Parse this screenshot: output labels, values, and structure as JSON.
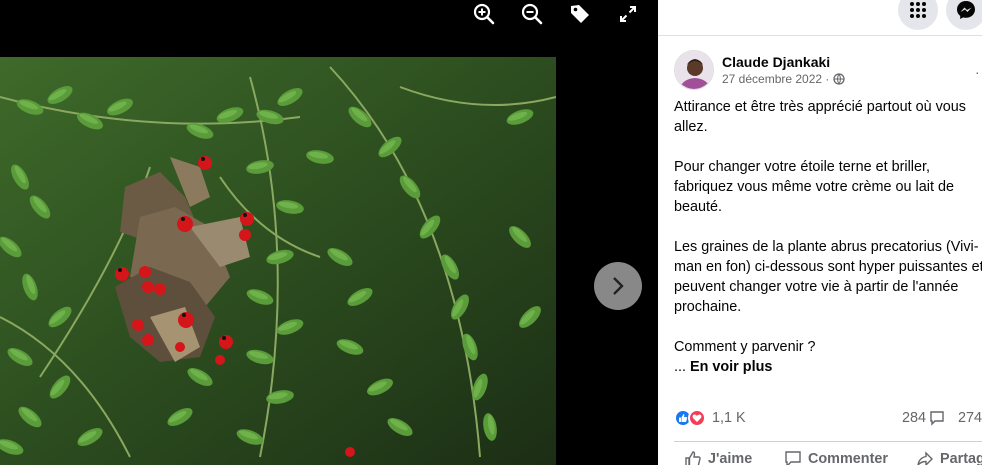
{
  "viewer": {
    "toolbar": {
      "zoom_in_icon": "zoom-in-icon",
      "zoom_out_icon": "zoom-out-icon",
      "tag_icon": "tag-icon",
      "fullscreen_icon": "fullscreen-icon"
    },
    "photo": {
      "subject": "abrus precatorius seed pods with red seeds among green leaves"
    },
    "next_icon": "chevron-right-icon"
  },
  "panel": {
    "top_buttons": {
      "menu_icon": "grid-menu-icon",
      "messenger_icon": "messenger-icon"
    },
    "author": {
      "name": "Claude Djankaki",
      "date": "27 décembre 2022 ·",
      "privacy_icon": "globe-icon"
    },
    "post": {
      "paragraphs": [
        "Attirance et être très apprécié partout où vous",
        "allez.",
        "Pour changer votre étoile terne et briller,",
        "fabriquez vous même votre crème ou lait de",
        "beauté.",
        "Les graines de la plante abrus precatorius (Vivi-",
        "man en fon) ci-dessous sont hyper puissantes et",
        "peuvent changer votre vie à partir de l'année",
        "prochaine.",
        "Comment y parvenir ?"
      ],
      "see_more_prefix": "...",
      "see_more": "En voir plus"
    },
    "stats": {
      "reactions": "1,1 K",
      "comments": "284",
      "shares": "274"
    },
    "actions": {
      "like": "J'aime",
      "comment": "Commenter",
      "share": "Partager"
    }
  },
  "colors": {
    "accent": "#1877f2",
    "love": "#f33e58",
    "muted": "#65676b"
  }
}
